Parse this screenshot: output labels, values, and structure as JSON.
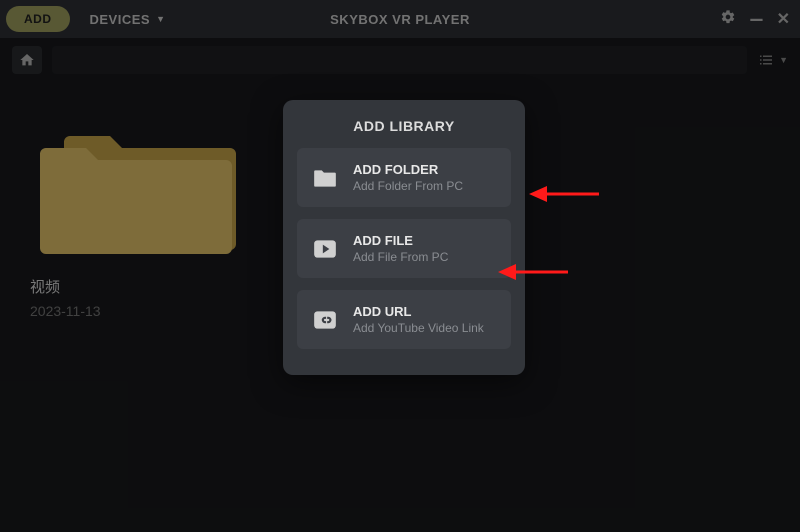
{
  "titlebar": {
    "add_label": "ADD",
    "devices_label": "DEVICES",
    "app_title": "SKYBOX VR PLAYER"
  },
  "library": {
    "folder_name": "视频",
    "folder_date": "2023-11-13"
  },
  "modal": {
    "title": "ADD LIBRARY",
    "options": {
      "folder": {
        "title": "ADD FOLDER",
        "sub": "Add Folder From PC"
      },
      "file": {
        "title": "ADD FILE",
        "sub": "Add File From PC"
      },
      "url": {
        "title": "ADD URL",
        "sub": "Add YouTube Video Link"
      }
    }
  }
}
